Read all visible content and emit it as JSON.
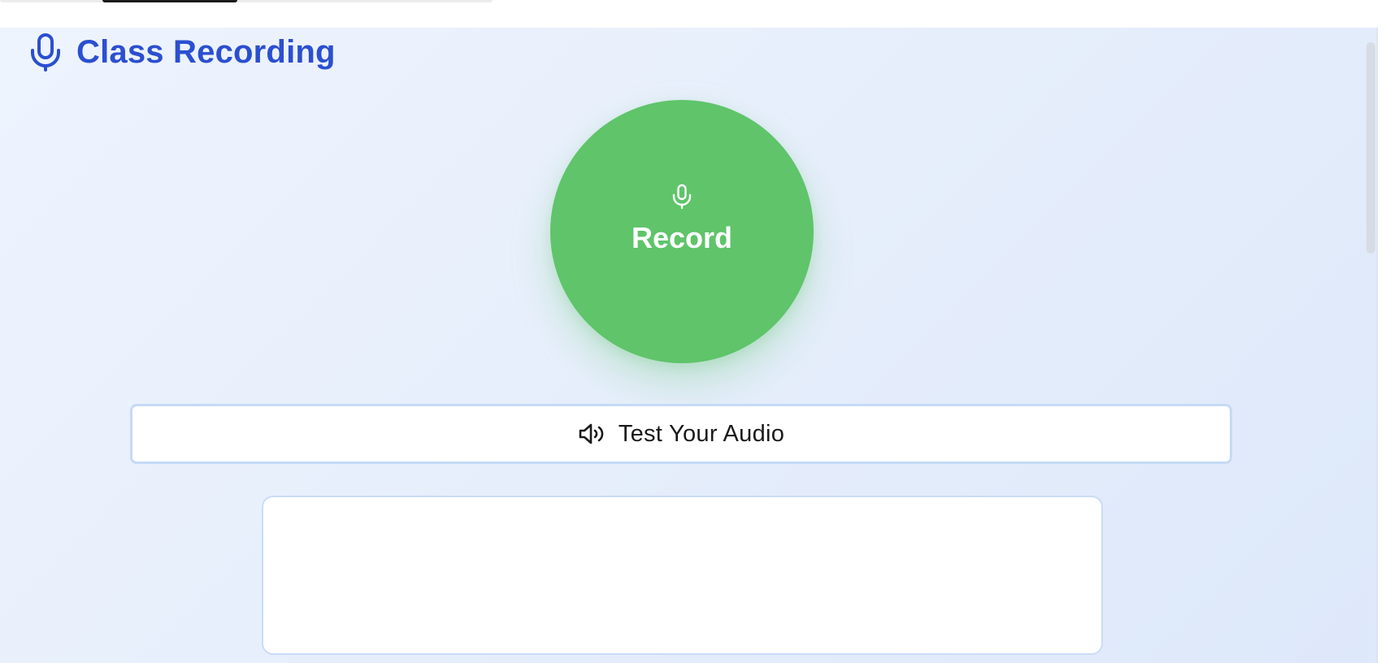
{
  "header": {
    "title": "Class Recording",
    "icon": "microphone-icon"
  },
  "record": {
    "label": "Record",
    "icon": "microphone-icon",
    "color": "#5fc46a"
  },
  "test_audio": {
    "label": "Test Your Audio",
    "icon": "speaker-icon"
  },
  "transcript": {
    "text": ""
  },
  "colors": {
    "accent": "#2b4fd0",
    "record_green": "#5fc46a",
    "border": "#c5daf6"
  }
}
